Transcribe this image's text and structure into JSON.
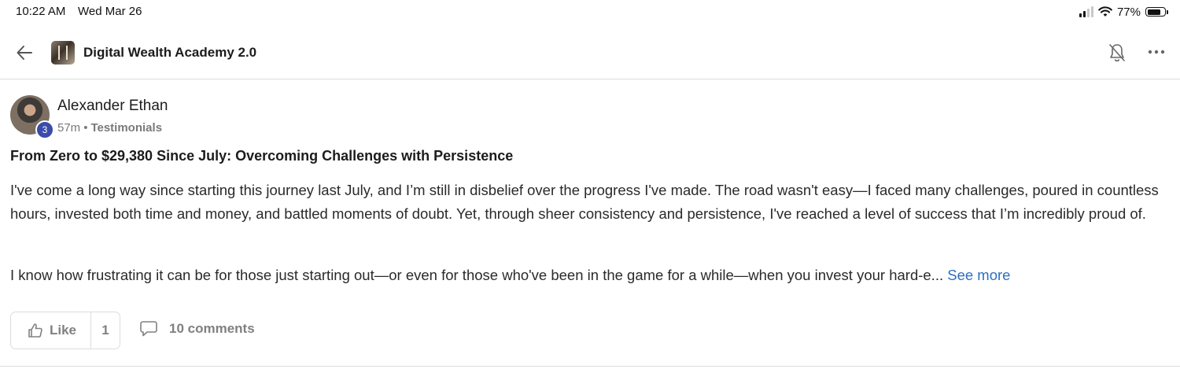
{
  "status_bar": {
    "time": "10:22 AM",
    "date": "Wed Mar 26",
    "battery_percent": "77%",
    "battery_level": 0.77,
    "signal_bars_active": 2,
    "signal_bars_total": 4
  },
  "header": {
    "back_icon": "arrow-left-icon",
    "group_name": "Digital Wealth Academy 2.0",
    "bell_icon": "bell-off-icon",
    "more_icon": "ellipsis-icon"
  },
  "post": {
    "author": "Alexander Ethan",
    "level": "3",
    "time_ago": "57m",
    "separator": "•",
    "category": "Testimonials",
    "title": "From Zero to $29,380 Since July: Overcoming Challenges with Persistence",
    "paragraph_1": "I've come a long way since starting this journey last July, and I’m still in disbelief over the progress I've made. The road wasn't easy—I faced many challenges, poured in countless hours, invested both time and money, and battled moments of doubt. Yet, through sheer consistency and persistence, I've reached a level of success that I’m incredibly proud of.",
    "paragraph_2": "I know how frustrating it can be for those just starting out—or even for those who've been in the game for a while—when you invest your hard-e...",
    "see_more": "See more"
  },
  "actions": {
    "like_label": "Like",
    "like_count": "1",
    "comments_label": "10 comments"
  },
  "colors": {
    "link": "#2e6fbd",
    "badge": "#3b4ba8",
    "muted": "#808080"
  }
}
